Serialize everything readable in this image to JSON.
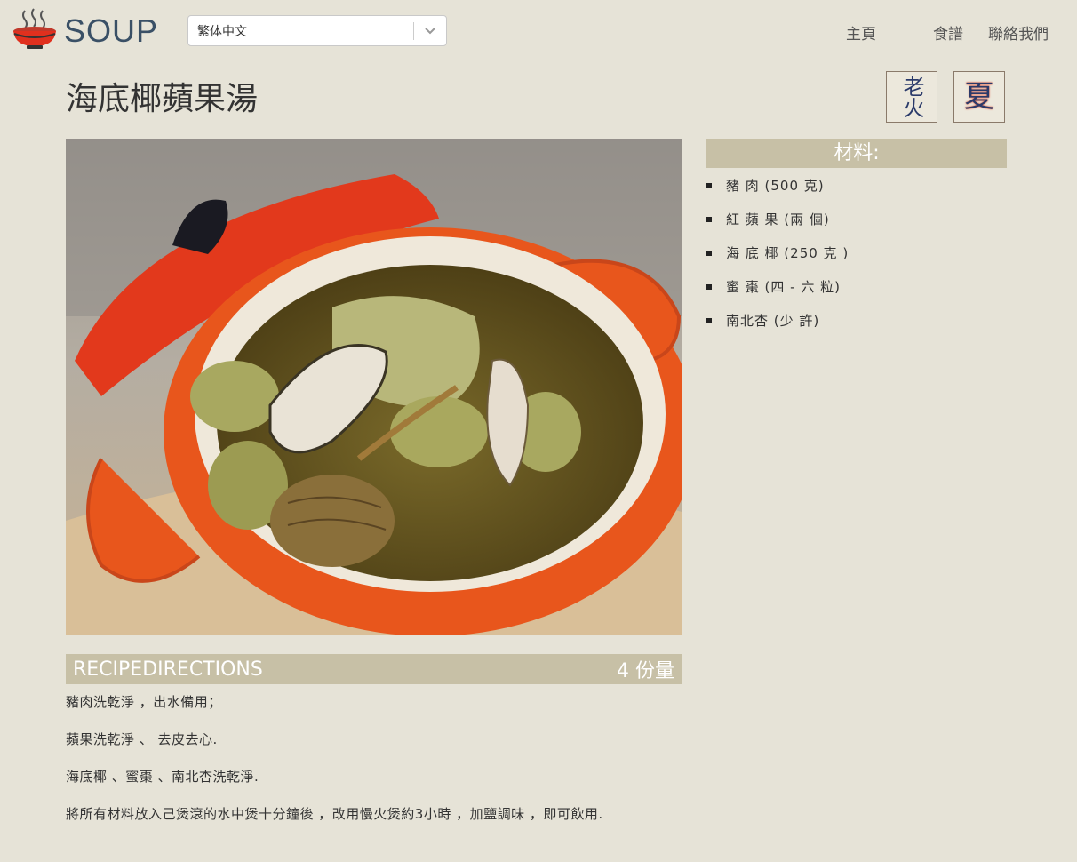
{
  "header": {
    "logo_text": "SOUP",
    "language": {
      "selected": "繁体中文"
    },
    "nav": {
      "home": "主頁",
      "recipes": "食譜",
      "contact": "聯絡我們"
    }
  },
  "recipe": {
    "title": "海底椰蘋果湯",
    "badges": [
      "老火",
      "夏"
    ],
    "ingredients_heading": "材料:",
    "ingredients": [
      "豬 肉 (500 克)",
      "紅 蘋 果 (兩 個)",
      "海 底 椰 (250 克 )",
      "蜜 棗 (四 - 六 粒)",
      "南北杏 (少 許)"
    ],
    "directions_heading": "RECIPEDIRECTIONS",
    "servings": "4 份量",
    "steps": [
      "豬肉洗乾淨 ，出水備用；",
      "蘋果洗乾淨 、 去皮去心.",
      "海底椰 、蜜棗 、南北杏洗乾淨.",
      "將所有材料放入己煲滾的水中煲十分鐘後 ，改用慢火煲約3小時 ，加鹽調味 ，即可飲用."
    ]
  },
  "colors": {
    "background": "#e6e3d7",
    "section_header": "#c7c0a6",
    "pot": "#e85a1c"
  },
  "icons": {
    "logo": "steaming-soup-bowl-icon",
    "dropdown": "chevron-down-icon"
  }
}
